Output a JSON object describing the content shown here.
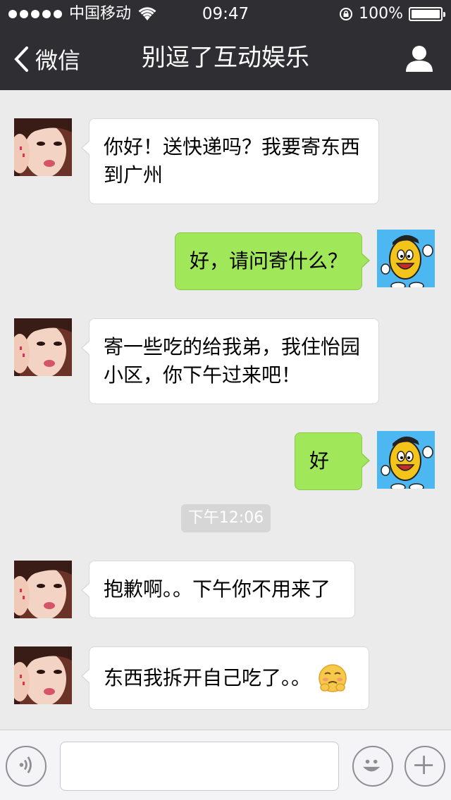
{
  "status_bar": {
    "carrier": "中国移动",
    "time": "09:47",
    "battery": "100%"
  },
  "nav": {
    "back_label": "微信",
    "title": "别逗了互动娱乐"
  },
  "messages": [
    {
      "side": "in",
      "text": "你好！送快递吗？我要寄东西到广州"
    },
    {
      "side": "out",
      "text": "好，请问寄什么？"
    },
    {
      "side": "in",
      "text": "寄一些吃的给我弟，我住怡园小区，你下午过来吧！"
    },
    {
      "side": "out",
      "text": "好"
    },
    {
      "side": "in",
      "text": "抱歉啊。。下午你不用来了"
    },
    {
      "side": "in",
      "text": "东西我拆开自己吃了。。",
      "emoji": "embarrassed-face-emoji"
    }
  ],
  "timestamp": "下午12:06",
  "input": {
    "value": "",
    "placeholder": ""
  },
  "colors": {
    "nav_bg": "#2f2f33",
    "chat_bg": "#ebebeb",
    "out_bubble": "#a0e75a",
    "in_bubble": "#ffffff"
  }
}
